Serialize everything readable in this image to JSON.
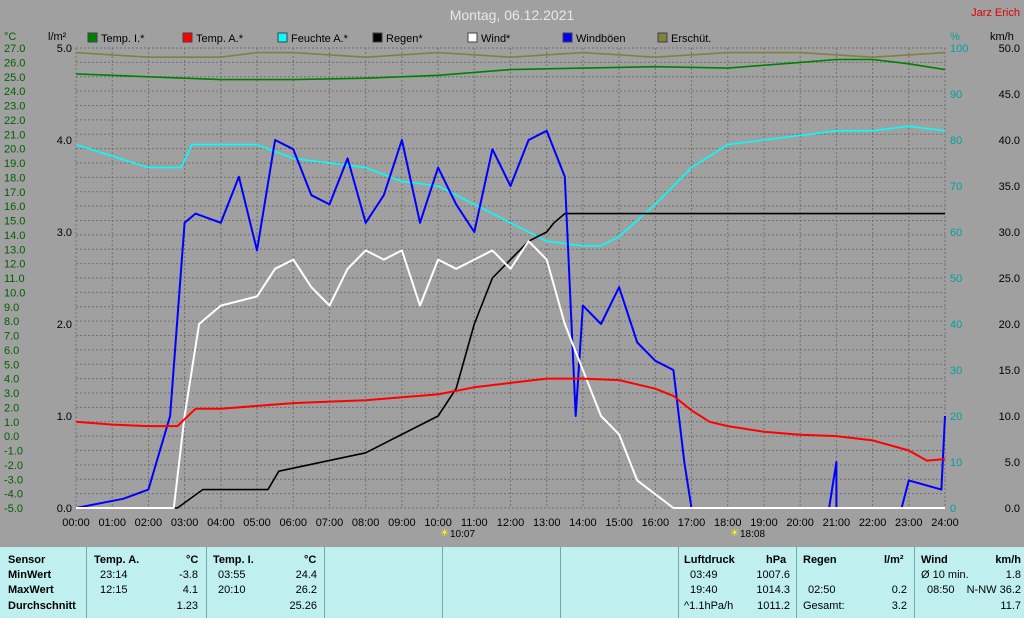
{
  "title": "Montag, 06.12.2021",
  "author": "Jarz Erich",
  "legend": [
    {
      "name": "Temp. I.*",
      "color": "#008000"
    },
    {
      "name": "Temp. A.*",
      "color": "#ff0000"
    },
    {
      "name": "Feuchte A.*",
      "color": "#00ffff"
    },
    {
      "name": "Regen*",
      "color": "#000000"
    },
    {
      "name": "Wind*",
      "color": "#ffffff"
    },
    {
      "name": "Windböen",
      "color": "#0000ff"
    },
    {
      "name": "Erschüt.",
      "color": "#808040"
    }
  ],
  "units": {
    "temp": "°C",
    "rain": "l/m²",
    "hum": "%",
    "wind": "km/h"
  },
  "sun": {
    "rise": "10:07",
    "set": "18:08"
  },
  "chart_data": {
    "type": "line",
    "title": "Montag, 06.12.2021",
    "x_ticks": [
      "00:00",
      "01:00",
      "02:00",
      "03:00",
      "04:00",
      "05:00",
      "06:00",
      "07:00",
      "08:00",
      "09:00",
      "10:00",
      "11:00",
      "12:00",
      "13:00",
      "14:00",
      "15:00",
      "16:00",
      "17:00",
      "18:00",
      "19:00",
      "20:00",
      "21:00",
      "22:00",
      "23:00",
      "24:00"
    ],
    "axes": {
      "temp": {
        "label": "°C",
        "range": [
          -5.0,
          27.0
        ],
        "ticks": [
          "27.0",
          "26.0",
          "25.0",
          "24.0",
          "23.0",
          "22.0",
          "21.0",
          "20.0",
          "19.0",
          "18.0",
          "17.0",
          "16.0",
          "15.0",
          "14.0",
          "13.0",
          "12.0",
          "11.0",
          "10.0",
          "9.0",
          "8.0",
          "7.0",
          "6.0",
          "5.0",
          "4.0",
          "3.0",
          "2.0",
          "1.0",
          "0.0",
          "-1.0",
          "-2.0",
          "-3.0",
          "-4.0",
          "-5.0"
        ]
      },
      "rain": {
        "label": "l/m²",
        "range": [
          0,
          5
        ],
        "ticks": [
          "5.0",
          "4.0",
          "3.0",
          "2.0",
          "1.0",
          "0.0"
        ]
      },
      "hum": {
        "label": "%",
        "range": [
          0,
          100
        ],
        "ticks": [
          "100",
          "90",
          "80",
          "70",
          "60",
          "50",
          "40",
          "30",
          "20",
          "10",
          "0"
        ]
      },
      "wind": {
        "label": "km/h",
        "range": [
          0,
          50
        ],
        "ticks": [
          "50.0",
          "45.0",
          "40.0",
          "35.0",
          "30.0",
          "25.0",
          "20.0",
          "15.0",
          "10.0",
          "5.0",
          "0.0"
        ]
      }
    },
    "series": [
      {
        "name": "Temp. I.*",
        "axis": "temp",
        "color": "#008000",
        "x": [
          0,
          2,
          4,
          6,
          8,
          10,
          12,
          14,
          16,
          18,
          20,
          21,
          22,
          23,
          24
        ],
        "y": [
          25.2,
          25.0,
          24.8,
          24.8,
          24.9,
          25.1,
          25.5,
          25.6,
          25.7,
          25.6,
          26.0,
          26.2,
          26.2,
          25.9,
          25.5
        ]
      },
      {
        "name": "Temp. A.*",
        "axis": "temp",
        "color": "#ff0000",
        "x": [
          0,
          1,
          2,
          2.8,
          3.3,
          4,
          5,
          6,
          7,
          8,
          9,
          10,
          11,
          12,
          13,
          14,
          15,
          16,
          16.5,
          17,
          17.5,
          18,
          19,
          20,
          21,
          22,
          23,
          23.5,
          24
        ],
        "y": [
          1.0,
          0.8,
          0.7,
          0.7,
          1.9,
          1.9,
          2.1,
          2.3,
          2.4,
          2.5,
          2.7,
          2.9,
          3.4,
          3.7,
          4.0,
          4.0,
          3.9,
          3.3,
          2.8,
          1.8,
          1.0,
          0.7,
          0.3,
          0.1,
          0,
          -0.3,
          -1.0,
          -1.7,
          -1.6
        ]
      },
      {
        "name": "Feuchte A.*",
        "axis": "hum",
        "color": "#00ffff",
        "x": [
          0,
          2,
          2.9,
          3.2,
          4,
          5,
          6,
          7,
          8,
          9,
          10,
          11,
          12,
          13,
          14,
          14.5,
          15,
          16,
          17,
          18,
          19,
          20,
          21,
          22,
          23,
          24
        ],
        "y": [
          79,
          74,
          74,
          79,
          79,
          79,
          76,
          75,
          74,
          71,
          70,
          66,
          62,
          58,
          57,
          57,
          59,
          66,
          74,
          79,
          80,
          81,
          82,
          82,
          83,
          82
        ]
      },
      {
        "name": "Regen*",
        "axis": "rain",
        "color": "#000000",
        "x": [
          0,
          2.8,
          3.5,
          5.3,
          5.6,
          8,
          9,
          10,
          10.5,
          11,
          11.5,
          12,
          12.5,
          13,
          13.2,
          13.5,
          14,
          24
        ],
        "y": [
          0,
          0,
          0.2,
          0.2,
          0.4,
          0.6,
          0.8,
          1.0,
          1.3,
          2.0,
          2.5,
          2.7,
          2.9,
          3.0,
          3.1,
          3.2,
          3.2,
          3.2
        ]
      },
      {
        "name": "Wind*",
        "axis": "wind",
        "color": "#ffffff",
        "x": [
          0,
          2.7,
          3.0,
          3.4,
          4,
          5,
          5.5,
          6,
          6.5,
          7,
          7.5,
          8,
          8.5,
          9,
          9.5,
          10,
          10.5,
          11,
          11.5,
          12,
          12.5,
          13,
          13.5,
          14,
          14.5,
          15,
          15.5,
          16,
          16.5,
          17,
          24
        ],
        "y": [
          0,
          0,
          10,
          20,
          22,
          23,
          26,
          27,
          24,
          22,
          26,
          28,
          27,
          28,
          22,
          27,
          26,
          27,
          28,
          26,
          29,
          27,
          20,
          15,
          10,
          8,
          3,
          1.5,
          0,
          0,
          0
        ]
      },
      {
        "name": "Windböen",
        "axis": "wind",
        "color": "#0000ff",
        "x": [
          0,
          1.3,
          2,
          2.6,
          3.0,
          3.3,
          4,
          4.5,
          5,
          5.5,
          6,
          6.5,
          7,
          7.5,
          8,
          8.5,
          9,
          9.5,
          10,
          10.5,
          11,
          11.5,
          12,
          12.5,
          13,
          13.5,
          13.8,
          14,
          14.5,
          15,
          15.5,
          16,
          16.5,
          16.8,
          17,
          20.8,
          21,
          21,
          22.8,
          23,
          23.9,
          24
        ],
        "y": [
          0,
          1,
          2,
          10,
          31,
          32,
          31,
          36,
          28,
          40,
          39,
          34,
          33,
          38,
          31,
          34,
          40,
          31,
          37,
          33,
          30,
          39,
          35,
          40,
          41,
          36,
          10,
          22,
          20,
          24,
          18,
          16,
          15,
          5,
          0,
          0,
          5,
          0,
          0,
          3,
          2,
          10
        ]
      },
      {
        "name": "Erschüt.",
        "axis": "hum",
        "color": "#808040",
        "x": [
          0,
          2,
          3,
          4,
          5,
          6,
          8,
          10,
          12,
          14,
          16,
          18,
          20,
          22,
          24
        ],
        "y": [
          99,
          98,
          98,
          98,
          99,
          99,
          98,
          99,
          98,
          99,
          98,
          99,
          99,
          98,
          99
        ]
      }
    ]
  },
  "table": {
    "h_sensor": "Sensor",
    "h_ta": "Temp. A.",
    "h_ta_u": "°C",
    "h_ti": "Temp. I.",
    "h_ti_u": "°C",
    "r_min": "MinWert",
    "r_max": "MaxWert",
    "r_avg": "Durchschnitt",
    "ta_min_t": "23:14",
    "ta_min_v": "-3.8",
    "ta_max_t": "12:15",
    "ta_max_v": "4.1",
    "ta_avg": "1.23",
    "ti_min_t": "03:55",
    "ti_min_v": "24.4",
    "ti_max_t": "20:10",
    "ti_max_v": "26.2",
    "ti_avg": "25.26",
    "h_press": "Luftdruck",
    "h_press_u": "hPa",
    "p_min_t": "03:49",
    "p_min_v": "1007.6",
    "p_max_t": "19:40",
    "p_max_v": "1014.3",
    "p_trend": "^1.1hPa/h",
    "p_avg": "1011.2",
    "h_rain": "Regen",
    "h_rain_u": "l/m²",
    "r_max_t": "02:50",
    "r_max_v": "0.2",
    "r_tot_l": "Gesamt:",
    "r_tot_v": "3.2",
    "h_wind": "Wind",
    "h_wind_u": "km/h",
    "w_avg_l": "Ø 10 min.",
    "w_avg_v": "1.8",
    "w_max_t": "08:50",
    "w_max_v": "N-NW 36.2",
    "w_day": "11.7"
  }
}
